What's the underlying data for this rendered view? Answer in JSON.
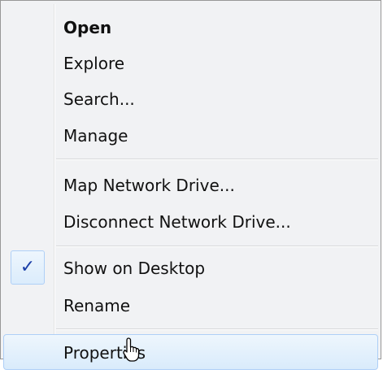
{
  "menu": {
    "items": [
      {
        "label": "Open",
        "bold": true
      },
      {
        "label": "Explore"
      },
      {
        "label": "Search..."
      },
      {
        "label": "Manage"
      },
      {
        "label": "Map Network Drive..."
      },
      {
        "label": "Disconnect Network Drive..."
      },
      {
        "label": "Show on Desktop",
        "checked": true
      },
      {
        "label": "Rename"
      },
      {
        "label": "Properties",
        "hovered": true
      }
    ],
    "check_glyph": "✓"
  },
  "icons": {
    "check": "checkmark-icon",
    "cursor": "pointer-cursor-icon"
  },
  "colors": {
    "menu_background": "#f1f2f4",
    "hover_highlight": "#d9ebfb",
    "hover_border": "#aecff7",
    "check_color": "#1b3fa8"
  }
}
